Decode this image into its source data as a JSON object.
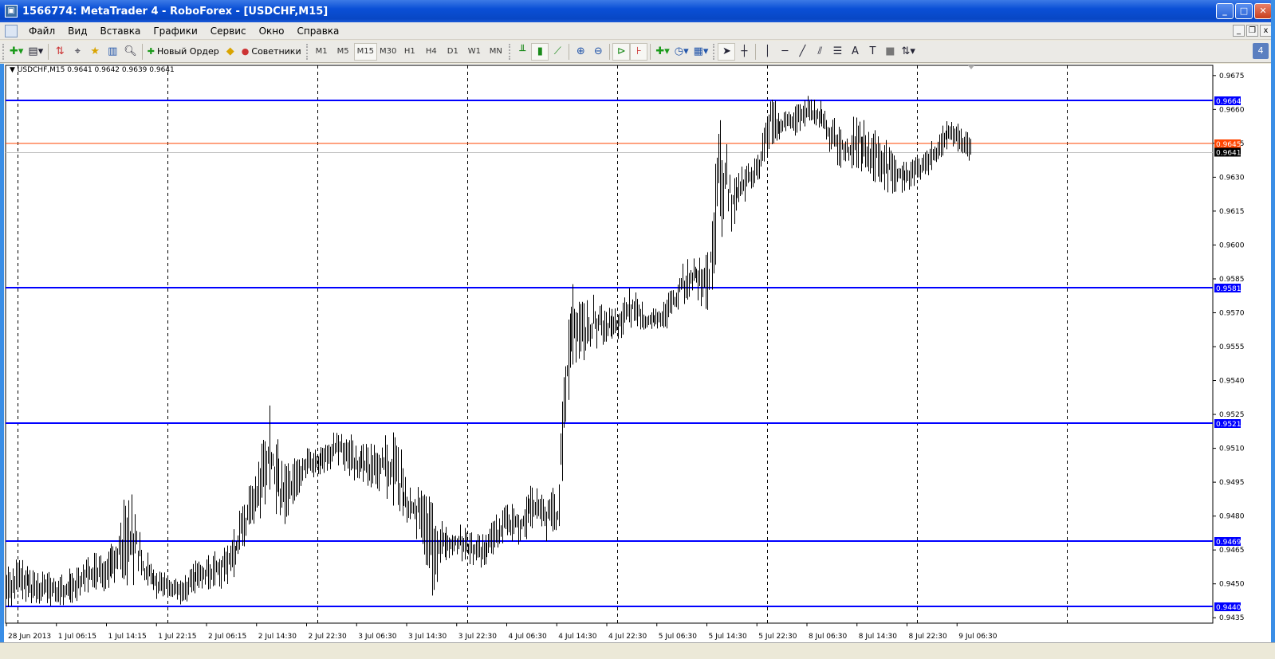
{
  "window": {
    "title": "1566774: MetaTrader 4 - RoboForex - [USDCHF,M15]",
    "buttons": [
      "minimize",
      "maximize",
      "close"
    ]
  },
  "menu": {
    "items": [
      "Файл",
      "Вид",
      "Вставка",
      "Графики",
      "Сервис",
      "Окно",
      "Справка"
    ]
  },
  "toolbar": {
    "new_order": "Новый Ордер",
    "experts": "Советники",
    "timeframes": [
      "M1",
      "M5",
      "M15",
      "M30",
      "H1",
      "H4",
      "D1",
      "W1",
      "MN"
    ],
    "active_timeframe": "M15",
    "badge": "4"
  },
  "chart_header": "USDCHF,M15  0.9641 0.9642 0.9639 0.9641",
  "chart_data": {
    "type": "bar",
    "symbol": "USDCHF",
    "timeframe": "M15",
    "ylim": [
      0.943,
      0.968
    ],
    "y_ticks": [
      "0.9675",
      "0.9660",
      "0.9645",
      "0.9630",
      "0.9615",
      "0.9600",
      "0.9585",
      "0.9570",
      "0.9555",
      "0.9540",
      "0.9525",
      "0.9510",
      "0.9495",
      "0.9480",
      "0.9465",
      "0.9450",
      "0.9435"
    ],
    "x_ticks": [
      "28 Jun 2013",
      "1 Jul 06:15",
      "1 Jul 14:15",
      "1 Jul 22:15",
      "2 Jul 06:15",
      "2 Jul 14:30",
      "2 Jul 22:30",
      "3 Jul 06:30",
      "3 Jul 14:30",
      "3 Jul 22:30",
      "4 Jul 06:30",
      "4 Jul 14:30",
      "4 Jul 22:30",
      "5 Jul 06:30",
      "5 Jul 14:30",
      "5 Jul 22:30",
      "8 Jul 06:30",
      "8 Jul 14:30",
      "8 Jul 22:30",
      "9 Jul 06:30"
    ],
    "grid": true,
    "high_low": [
      [
        0.9458,
        0.944
      ],
      [
        0.946,
        0.9444
      ],
      [
        0.9456,
        0.9442
      ],
      [
        0.9455,
        0.9443
      ],
      [
        0.9452,
        0.9441
      ],
      [
        0.9455,
        0.944
      ],
      [
        0.946,
        0.9447
      ],
      [
        0.9462,
        0.9449
      ],
      [
        0.946,
        0.9448
      ],
      [
        0.9478,
        0.9455
      ],
      [
        0.9501,
        0.9448
      ],
      [
        0.9465,
        0.9448
      ],
      [
        0.9455,
        0.9445
      ],
      [
        0.9452,
        0.9446
      ],
      [
        0.945,
        0.9442
      ],
      [
        0.9458,
        0.9447
      ],
      [
        0.9462,
        0.9449
      ],
      [
        0.9465,
        0.9448
      ],
      [
        0.9472,
        0.9452
      ],
      [
        0.9487,
        0.9468
      ],
      [
        0.95,
        0.9478
      ],
      [
        0.9527,
        0.949
      ],
      [
        0.9505,
        0.9475
      ],
      [
        0.9505,
        0.9488
      ],
      [
        0.951,
        0.9497
      ],
      [
        0.9508,
        0.95
      ],
      [
        0.9515,
        0.9503
      ],
      [
        0.952,
        0.95
      ],
      [
        0.951,
        0.9497
      ],
      [
        0.951,
        0.9495
      ],
      [
        0.9512,
        0.9492
      ],
      [
        0.952,
        0.948
      ],
      [
        0.9495,
        0.9475
      ],
      [
        0.9492,
        0.947
      ],
      [
        0.9488,
        0.9445
      ],
      [
        0.9474,
        0.9462
      ],
      [
        0.9475,
        0.9462
      ],
      [
        0.9472,
        0.946
      ],
      [
        0.947,
        0.9458
      ],
      [
        0.9478,
        0.9465
      ],
      [
        0.9484,
        0.947
      ],
      [
        0.9487,
        0.9468
      ],
      [
        0.9494,
        0.9475
      ],
      [
        0.9488,
        0.947
      ],
      [
        0.9496,
        0.9468
      ],
      [
        0.9584,
        0.954
      ],
      [
        0.9575,
        0.955
      ],
      [
        0.9578,
        0.9555
      ],
      [
        0.957,
        0.9558
      ],
      [
        0.9572,
        0.956
      ],
      [
        0.9582,
        0.9565
      ],
      [
        0.957,
        0.9563
      ],
      [
        0.957,
        0.9565
      ],
      [
        0.9578,
        0.9565
      ],
      [
        0.959,
        0.9575
      ],
      [
        0.9595,
        0.958
      ],
      [
        0.9595,
        0.9566
      ],
      [
        0.966,
        0.9605
      ],
      [
        0.963,
        0.9608
      ],
      [
        0.9635,
        0.962
      ],
      [
        0.9638,
        0.9628
      ],
      [
        0.9665,
        0.9645
      ],
      [
        0.9658,
        0.9648
      ],
      [
        0.966,
        0.965
      ],
      [
        0.9664,
        0.9655
      ],
      [
        0.9662,
        0.965
      ],
      [
        0.9655,
        0.964
      ],
      [
        0.965,
        0.9632
      ],
      [
        0.966,
        0.9635
      ],
      [
        0.965,
        0.9632
      ],
      [
        0.9648,
        0.9625
      ],
      [
        0.9638,
        0.9624
      ],
      [
        0.9635,
        0.9626
      ],
      [
        0.9638,
        0.963
      ],
      [
        0.9645,
        0.9634
      ],
      [
        0.9653,
        0.9644
      ],
      [
        0.9652,
        0.9643
      ],
      [
        0.9648,
        0.9638
      ]
    ],
    "horizontal_lines": [
      {
        "price": "0.9664",
        "color": "#0000ff"
      },
      {
        "price": "0.9581",
        "color": "#0000ff"
      },
      {
        "price": "0.9521",
        "color": "#0000ff"
      },
      {
        "price": "0.9469",
        "color": "#0000ff"
      },
      {
        "price": "0.9440",
        "color": "#0000ff"
      },
      {
        "price": "0.9645",
        "color": "#ff4500"
      }
    ],
    "bid": {
      "price": "0.9641",
      "color": "#000000",
      "line_color": "#c0c0c0"
    },
    "bar_color": "#000000",
    "background": "#ffffff"
  }
}
